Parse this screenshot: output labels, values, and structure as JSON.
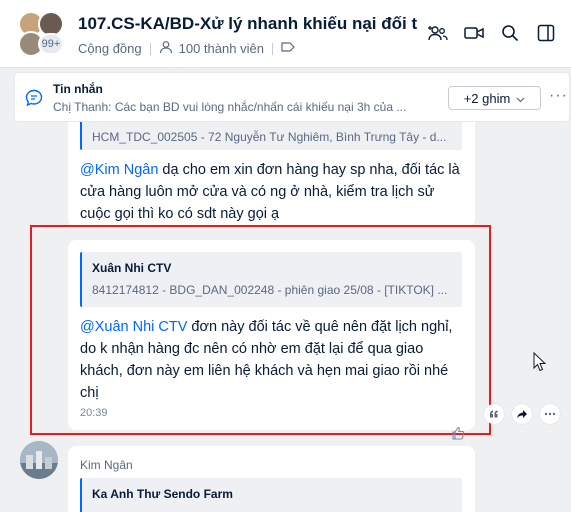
{
  "header": {
    "title": "107.CS-KA/BD-Xử lý nhanh khiếu nại đối t",
    "avatar_count": "99+",
    "community_label": "Cộng đồng",
    "members_label": "100 thành viên"
  },
  "pinned": {
    "title": "Tin nhắn",
    "text": "Chị Thanh: Các bạn BD vui lòng nhắc/nhấn cái khiếu nại 3h của ...",
    "pin_button": "+2 ghim"
  },
  "messages": [
    {
      "quote_text": "HCM_TDC_002505 - 72 Nguyễn Tư Nghiêm, Bình Trưng Tây - d...",
      "mention": "@Kim Ngân",
      "line1": " dạ cho em xin đơn hàng hay sp nha, đối tác là",
      "line2": "cửa hàng luôn mở cửa và có ng ở nhà, kiểm tra lịch sử",
      "line3": "cuộc gọi thì ko có sdt này gọi ạ"
    },
    {
      "quote_name": "Xuân Nhi CTV",
      "quote_text": "8412174812 - BDG_DAN_002248 - phiên giao 25/08 - [TIKTOK] ...",
      "mention": "@Xuân Nhi CTV",
      "line1": " đơn này đối tác về quê nên đặt lịch nghỉ,",
      "line2": "do k nhận hàng đc nên có nhờ em đặt lại để qua giao",
      "line3": "khách, đơn này em liên hệ khách và hẹn mai giao rồi nhé",
      "line4": "chị",
      "time": "20:39"
    },
    {
      "sender": "Kim Ngân",
      "quote_name": "Ka Anh Thư Sendo Farm"
    }
  ],
  "colors": {
    "accent": "#0068ff",
    "highlight_box": "#e02020"
  }
}
